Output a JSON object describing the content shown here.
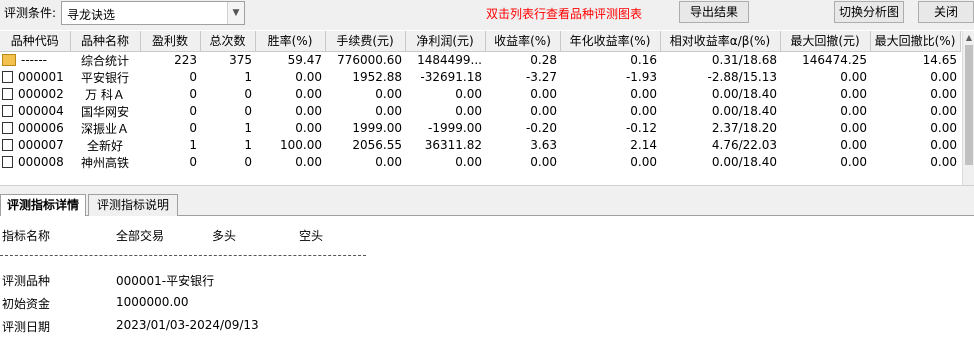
{
  "toolbar": {
    "condition_label": "评测条件:",
    "condition_value": "寻龙诀选",
    "hint": "双击列表行查看品种评测图表",
    "export_label": "导出结果",
    "switch_label": "切换分析图",
    "close_label": "关闭"
  },
  "table": {
    "headers": [
      "品种代码",
      "品种名称",
      "盈利数",
      "总次数",
      "胜率(%)",
      "手续费(元)",
      "净利润(元)",
      "收益率(%)",
      "年化收益率(%)",
      "相对收益率α/β(%)",
      "最大回撤(元)",
      "最大回撤比(%)"
    ],
    "rows": [
      [
        "------",
        "综合统计",
        "223",
        "375",
        "59.47",
        "776000.60",
        "1484499...",
        "0.28",
        "0.16",
        "0.31/18.68",
        "146474.25",
        "14.65"
      ],
      [
        "000001",
        "平安银行",
        "0",
        "1",
        "0.00",
        "1952.88",
        "-32691.18",
        "-3.27",
        "-1.93",
        "-2.88/15.13",
        "0.00",
        "0.00"
      ],
      [
        "000002",
        "万 科Ａ",
        "0",
        "0",
        "0.00",
        "0.00",
        "0.00",
        "0.00",
        "0.00",
        "0.00/18.40",
        "0.00",
        "0.00"
      ],
      [
        "000004",
        "国华网安",
        "0",
        "0",
        "0.00",
        "0.00",
        "0.00",
        "0.00",
        "0.00",
        "0.00/18.40",
        "0.00",
        "0.00"
      ],
      [
        "000006",
        "深振业Ａ",
        "0",
        "1",
        "0.00",
        "1999.00",
        "-1999.00",
        "-0.20",
        "-0.12",
        "2.37/18.20",
        "0.00",
        "0.00"
      ],
      [
        "000007",
        "全新好",
        "1",
        "1",
        "100.00",
        "2056.55",
        "36311.82",
        "3.63",
        "2.14",
        "4.76/22.03",
        "0.00",
        "0.00"
      ],
      [
        "000008",
        "神州高铁",
        "0",
        "0",
        "0.00",
        "0.00",
        "0.00",
        "0.00",
        "0.00",
        "0.00/18.40",
        "0.00",
        "0.00"
      ]
    ]
  },
  "tabs": [
    "评测指标详情",
    "评测指标说明"
  ],
  "detail": {
    "col_headers": [
      "指标名称",
      "全部交易",
      "多头",
      "空头"
    ],
    "lines": [
      {
        "label": "评测品种",
        "value": "000001-平安银行"
      },
      {
        "label": "初始资金",
        "value": "1000000.00"
      },
      {
        "label": "评测日期",
        "value": "2023/01/03-2024/09/13"
      }
    ]
  },
  "icons": {
    "summary": "folder-icon",
    "row": "document-icon",
    "dropdown": "chevron-down-icon"
  }
}
